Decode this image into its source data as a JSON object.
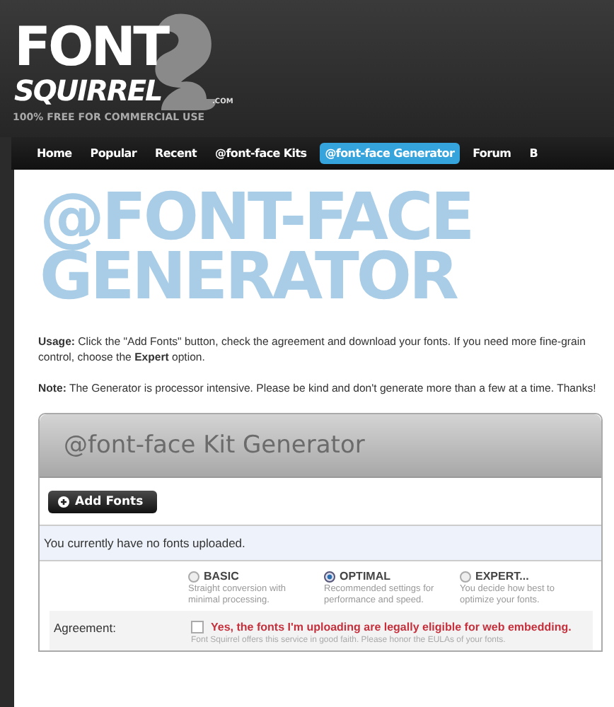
{
  "logo": {
    "line1": "FONT",
    "line2": "SQUIRREL",
    "domain": ".COM",
    "tagline": "100% FREE FOR COMMERCIAL USE"
  },
  "nav": [
    {
      "label": "Home",
      "selected": false
    },
    {
      "label": "Popular",
      "selected": false
    },
    {
      "label": "Recent",
      "selected": false
    },
    {
      "label": "@font-face Kits",
      "selected": false
    },
    {
      "label": "@font-face Generator",
      "selected": true
    },
    {
      "label": "Forum",
      "selected": false
    },
    {
      "label": "B",
      "selected": false
    }
  ],
  "page_title": [
    "@FONT-FACE",
    "GENERATOR"
  ],
  "usage": "**Usage:** Click the \"Add Fonts\" button, check the agreement and download your fonts. If you need more fine-grain control, choose the **Expert** option.",
  "note": "**Note:** The Generator is processor intensive. Please be kind and don't generate more than a few at a time. Thanks!",
  "kit": {
    "title": "@font-face Kit Generator",
    "add_button": "Add Fonts",
    "message": "You currently have no fonts uploaded.",
    "modes": [
      {
        "label": "BASIC",
        "description": "Straight conversion with minimal processing.",
        "selected": false
      },
      {
        "label": "OPTIMAL",
        "description": "Recommended settings for performance and speed.",
        "selected": true
      },
      {
        "label": "EXPERT...",
        "description": "You decide how best to optimize your fonts.",
        "selected": false
      }
    ],
    "agreement": {
      "label": "Agreement:",
      "checked": false,
      "text": "Yes, the fonts I'm uploading are legally eligible for web embedding.",
      "note": "Font Squirrel offers this service in good faith. Please honor the EULAs of your fonts."
    }
  }
}
